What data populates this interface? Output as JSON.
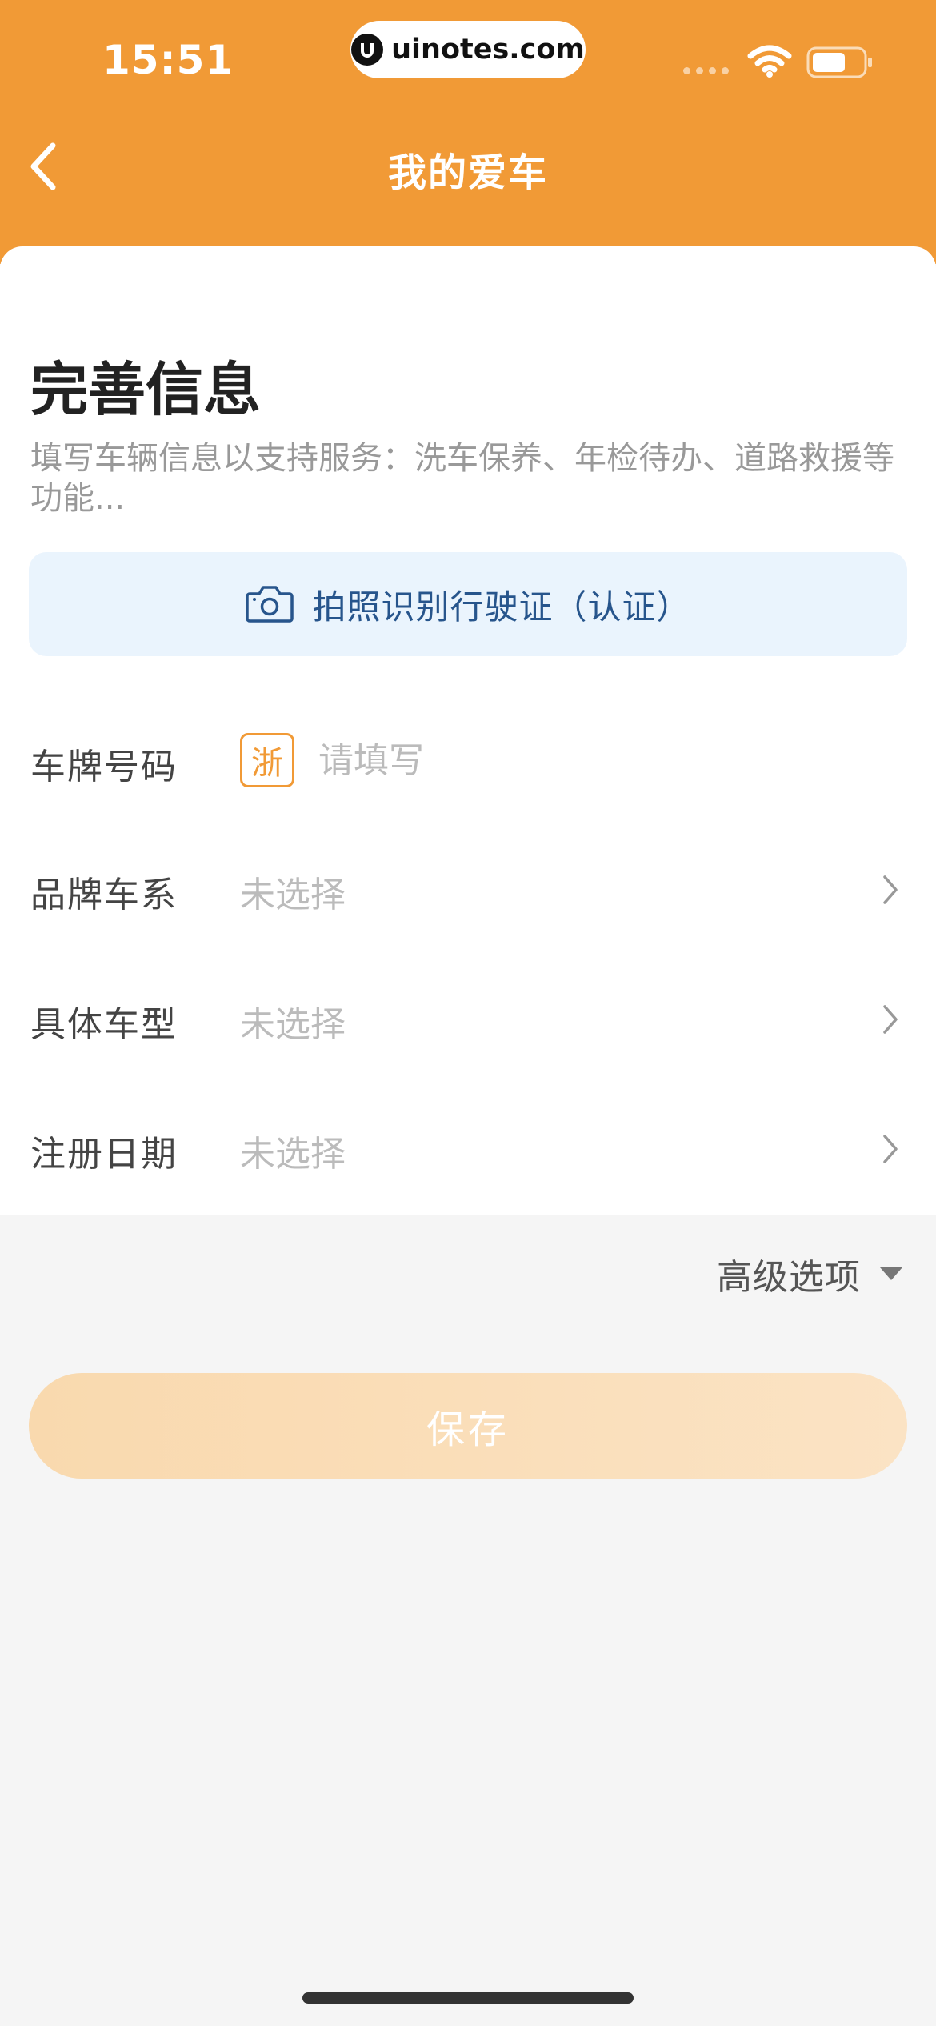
{
  "status_bar": {
    "time": "15:51",
    "url": "uinotes.com"
  },
  "nav": {
    "title": "我的爱车",
    "back_icon": "chevron-left-icon"
  },
  "form": {
    "title": "完善信息",
    "description": "填写车辆信息以支持服务：洗车保养、年检待办、道路救援等功能...",
    "scan_button": {
      "label": "拍照识别行驶证（认证）",
      "icon": "camera-icon"
    },
    "plate": {
      "label": "车牌号码",
      "province": "浙",
      "placeholder": "请填写"
    },
    "brand": {
      "label": "品牌车系",
      "value": "未选择"
    },
    "model": {
      "label": "具体车型",
      "value": "未选择"
    },
    "register_date": {
      "label": "注册日期",
      "value": "未选择"
    }
  },
  "advanced": {
    "label": "高级选项",
    "icon": "caret-down-icon"
  },
  "save": {
    "label": "保存"
  },
  "colors": {
    "brand_orange": "#F19A36",
    "scan_bg": "#EAF4FD",
    "scan_text": "#27558C",
    "save_disabled": "#F9D9AE"
  }
}
